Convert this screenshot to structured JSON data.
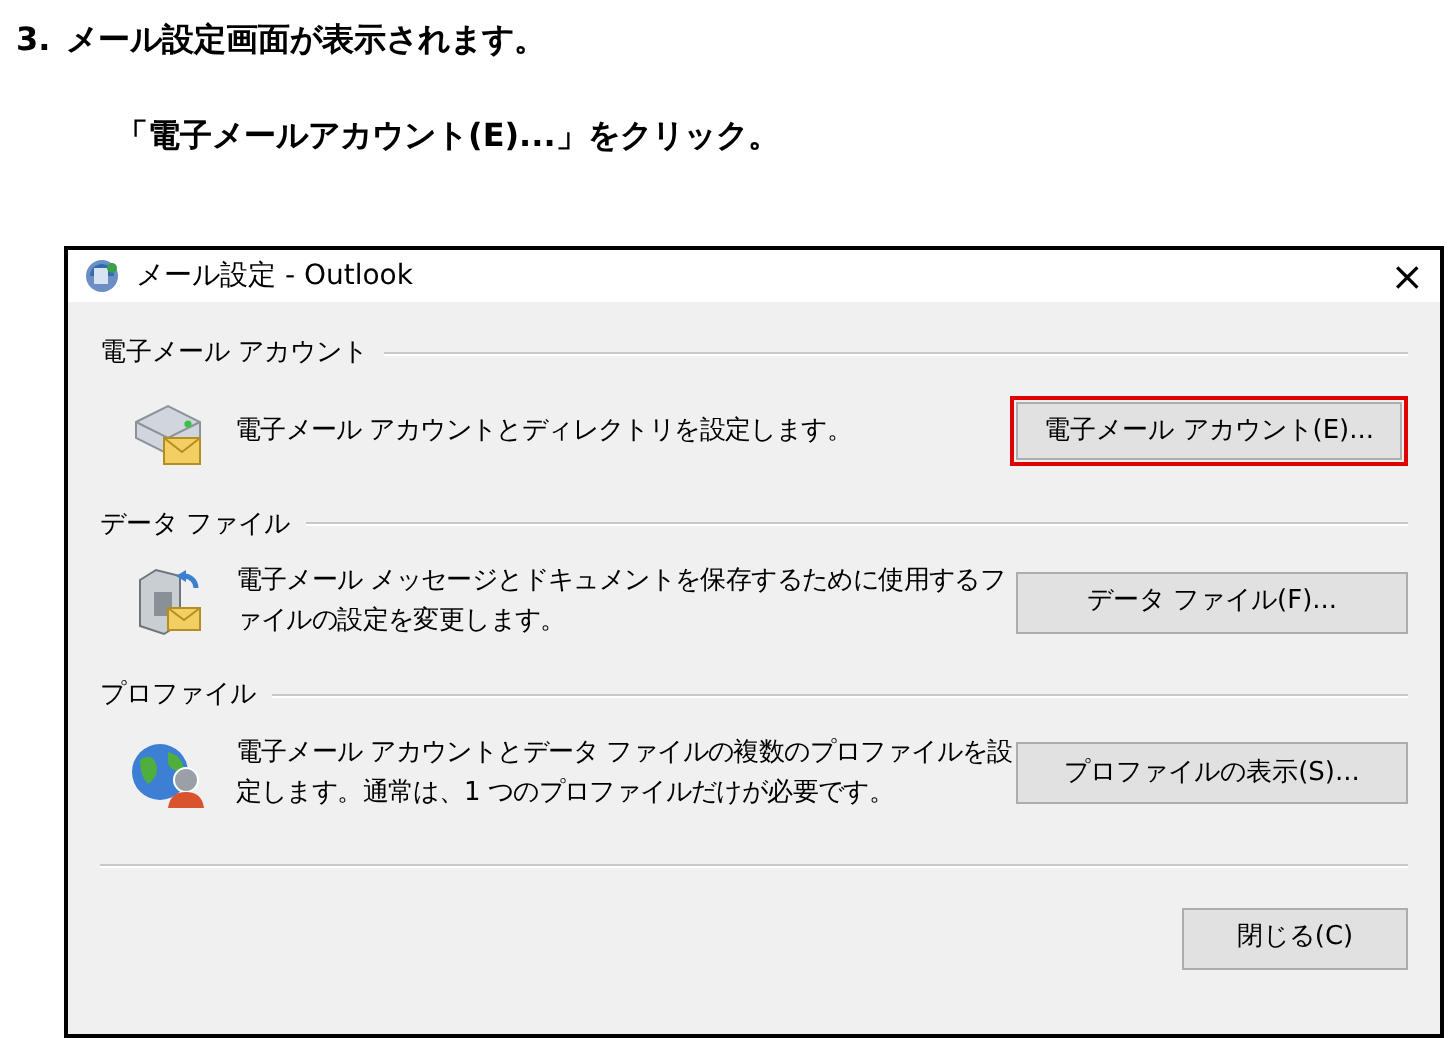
{
  "step": {
    "number": "3.",
    "text": "メール設定画面が表示されます。"
  },
  "instruction": "「電子メールアカウント(E)...」をクリック。",
  "dialog": {
    "title": "メール設定 - Outlook",
    "close": "×",
    "sections": [
      {
        "kind": "mail",
        "label": "電子メール アカウント",
        "description": "電子メール アカウントとディレクトリを設定します。",
        "button": "電子メール アカウント(E)...",
        "highlighted": true
      },
      {
        "kind": "data",
        "label": "データ ファイル",
        "description": "電子メール メッセージとドキュメントを保存するために使用するファイルの設定を変更します。",
        "button": "データ ファイル(F)...",
        "highlighted": false
      },
      {
        "kind": "profile",
        "label": "プロファイル",
        "description": "電子メール アカウントとデータ ファイルの複数のプロファイルを設定します。通常は、1 つのプロファイルだけが必要です。",
        "button": "プロファイルの表示(S)...",
        "highlighted": false
      }
    ],
    "footer_button": "閉じる(C)"
  }
}
